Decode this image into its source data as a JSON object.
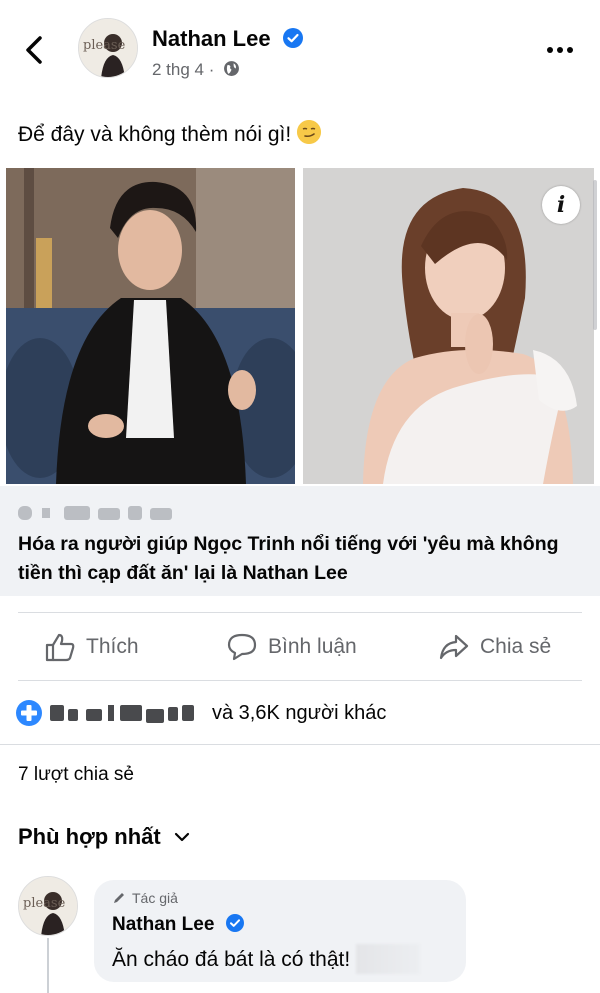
{
  "header": {
    "author_name": "Nathan Lee",
    "post_time": "2 thg 4 ·",
    "avatar_text": "please"
  },
  "post": {
    "text": "Để đây và không thèm nói gì!",
    "emoji": "smirk-emoji"
  },
  "link_card": {
    "title": "Hóa ra người giúp Ngọc Trinh nổi tiếng với 'yêu mà không tiền thì cạp đất ăn' lại là Nathan Lee"
  },
  "actions": {
    "like": "Thích",
    "comment": "Bình luận",
    "share": "Chia sẻ"
  },
  "reactions": {
    "others_text": "và 3,6K người khác"
  },
  "shares_text": "7 lượt chia sẻ",
  "sort_label": "Phù hợp nhất",
  "comment": {
    "badge": "Tác giả",
    "name": "Nathan Lee",
    "text": "Ăn cháo đá bát là có thật!"
  },
  "icons": {
    "back": "chevron-left-icon",
    "verified": "verified-badge-icon",
    "audience": "globe-icon",
    "more": "more-horizontal-icon",
    "info": "info-icon",
    "like": "thumbs-up-icon",
    "comment": "comment-bubble-icon",
    "share": "share-arrow-icon",
    "reaction": "care-reaction-icon",
    "sort": "chevron-down-icon",
    "author_badge": "pencil-icon"
  },
  "colors": {
    "verified_blue": "#1877f2",
    "secondary_text": "#65676b",
    "card_background": "#f0f2f5"
  }
}
